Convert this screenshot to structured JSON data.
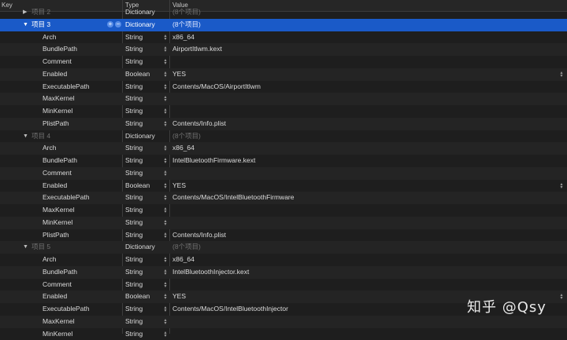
{
  "header": {
    "key": "Key",
    "type": "Type",
    "value": "Value"
  },
  "rows": [
    {
      "k": "项目 2",
      "t": "Dictionary",
      "v": "(8个项目)",
      "level": 1,
      "dict": true,
      "open": false,
      "dim": true
    },
    {
      "k": "项目 3",
      "t": "Dictionary",
      "v": "(8个项目)",
      "level": 1,
      "dict": true,
      "open": true,
      "selected": true
    },
    {
      "k": "Arch",
      "t": "String",
      "v": "x86_64",
      "level": 2
    },
    {
      "k": "BundlePath",
      "t": "String",
      "v": "AirportItlwm.kext",
      "level": 2
    },
    {
      "k": "Comment",
      "t": "String",
      "v": "",
      "level": 2
    },
    {
      "k": "Enabled",
      "t": "Boolean",
      "v": "YES",
      "level": 2,
      "bool": true
    },
    {
      "k": "ExecutablePath",
      "t": "String",
      "v": "Contents/MacOS/AirportItlwm",
      "level": 2
    },
    {
      "k": "MaxKernel",
      "t": "String",
      "v": "",
      "level": 2
    },
    {
      "k": "MinKernel",
      "t": "String",
      "v": "",
      "level": 2
    },
    {
      "k": "PlistPath",
      "t": "String",
      "v": "Contents/Info.plist",
      "level": 2
    },
    {
      "k": "项目 4",
      "t": "Dictionary",
      "v": "(8个项目)",
      "level": 1,
      "dict": true,
      "open": true,
      "dim": true
    },
    {
      "k": "Arch",
      "t": "String",
      "v": "x86_64",
      "level": 2
    },
    {
      "k": "BundlePath",
      "t": "String",
      "v": "IntelBluetoothFirmware.kext",
      "level": 2
    },
    {
      "k": "Comment",
      "t": "String",
      "v": "",
      "level": 2
    },
    {
      "k": "Enabled",
      "t": "Boolean",
      "v": "YES",
      "level": 2,
      "bool": true
    },
    {
      "k": "ExecutablePath",
      "t": "String",
      "v": "Contents/MacOS/IntelBluetoothFirmware",
      "level": 2
    },
    {
      "k": "MaxKernel",
      "t": "String",
      "v": "",
      "level": 2
    },
    {
      "k": "MinKernel",
      "t": "String",
      "v": "",
      "level": 2
    },
    {
      "k": "PlistPath",
      "t": "String",
      "v": "Contents/Info.plist",
      "level": 2
    },
    {
      "k": "项目 5",
      "t": "Dictionary",
      "v": "(8个项目)",
      "level": 1,
      "dict": true,
      "open": true,
      "dim": true
    },
    {
      "k": "Arch",
      "t": "String",
      "v": "x86_64",
      "level": 2
    },
    {
      "k": "BundlePath",
      "t": "String",
      "v": "IntelBluetoothInjector.kext",
      "level": 2
    },
    {
      "k": "Comment",
      "t": "String",
      "v": "",
      "level": 2
    },
    {
      "k": "Enabled",
      "t": "Boolean",
      "v": "YES",
      "level": 2,
      "bool": true
    },
    {
      "k": "ExecutablePath",
      "t": "String",
      "v": "Contents/MacOS/IntelBluetoothInjector",
      "level": 2
    },
    {
      "k": "MaxKernel",
      "t": "String",
      "v": "",
      "level": 2
    },
    {
      "k": "MinKernel",
      "t": "String",
      "v": "",
      "level": 2
    }
  ],
  "icons": {
    "disclosure_open": "▼",
    "disclosure_closed": "▶",
    "add": "+",
    "remove": "−",
    "stepper_up": "▴",
    "stepper_down": "▾"
  },
  "watermark": "知乎 @Qsy",
  "colors": {
    "selected_row": "#1a5ac8",
    "background": "#1e1e1e"
  }
}
